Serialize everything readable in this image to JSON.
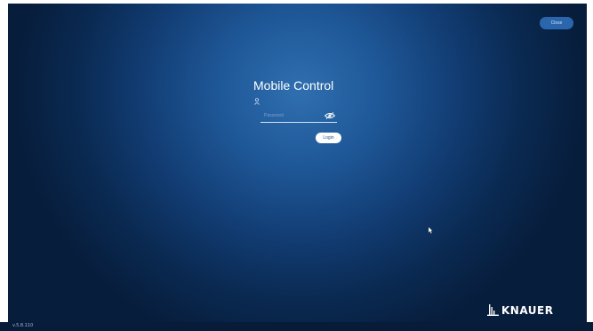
{
  "app": {
    "title": "Mobile Control",
    "version": "v.5.8.110"
  },
  "header": {
    "close_label": "Close"
  },
  "login": {
    "user_icon": "user-icon",
    "password_placeholder": "Password",
    "password_value": "",
    "show_password_icon": "eye-icon",
    "login_label": "Login"
  },
  "brand": {
    "logo_text": "KNAUER"
  },
  "colors": {
    "background_center": "#2f6fb0",
    "background_edge": "#071d3c",
    "close_button": "#2b66ad",
    "login_button": "#ffffff"
  }
}
